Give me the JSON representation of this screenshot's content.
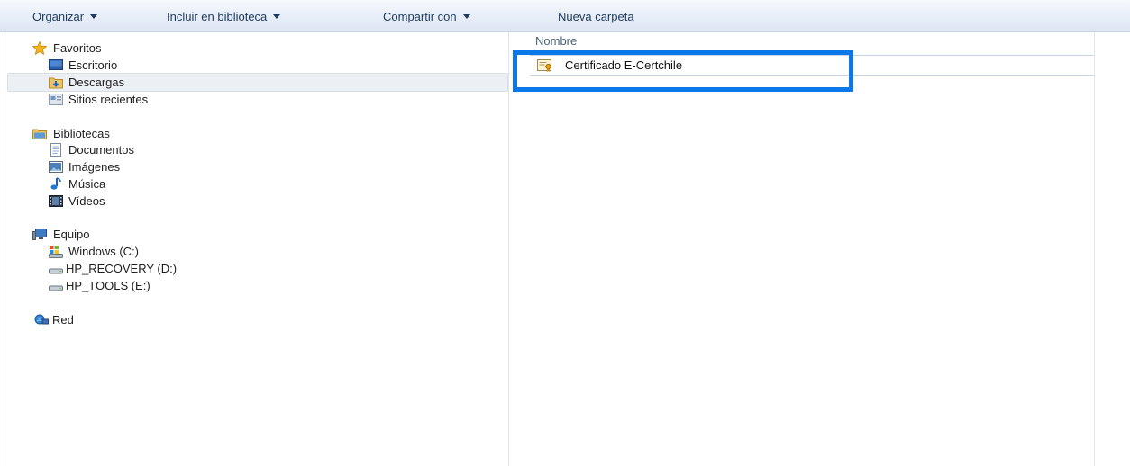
{
  "toolbar": {
    "organize": "Organizar",
    "include_library": "Incluir en biblioteca",
    "share_with": "Compartir con",
    "new_folder": "Nueva carpeta"
  },
  "nav": {
    "favorites": {
      "label": "Favoritos",
      "items": [
        "Escritorio",
        "Descargas",
        "Sitios recientes"
      ],
      "selected": "Descargas"
    },
    "libraries": {
      "label": "Bibliotecas",
      "items": [
        "Documentos",
        "Imágenes",
        "Música",
        "Vídeos"
      ]
    },
    "computer": {
      "label": "Equipo",
      "items": [
        "Windows (C:)",
        "HP_RECOVERY (D:)",
        "HP_TOOLS (E:)"
      ]
    },
    "network": {
      "label": "Red"
    }
  },
  "file_list": {
    "column_header": "Nombre",
    "files": [
      {
        "name": "Certificado E-Certchile",
        "icon": "certificate-icon",
        "highlighted": true
      }
    ]
  },
  "colors": {
    "highlight_box": "#0a78e8",
    "toolbar_text": "#1e395b",
    "selection_bg": "#eceff3"
  }
}
